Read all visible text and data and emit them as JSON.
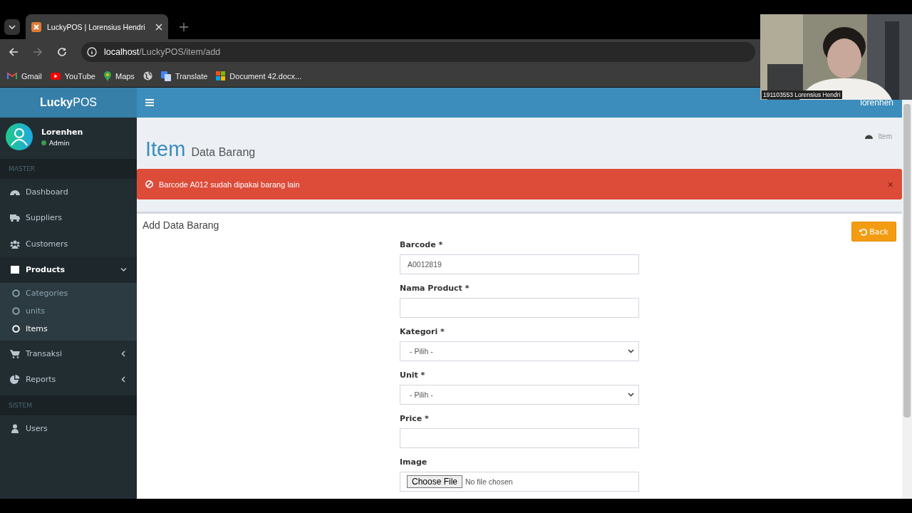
{
  "browser": {
    "tabs": [
      {
        "title": "LuckyPOS | Lorensius Hendri",
        "selected": true
      }
    ],
    "address": {
      "host": "localhost",
      "path": "/LuckyPOS/item/add"
    },
    "bookmarks": [
      "Gmail",
      "YouTube",
      "Maps",
      "Translate",
      "Document 42.docx..."
    ]
  },
  "webcam": {
    "caption": "191103553 Lorensius Hendri"
  },
  "app": {
    "brand": {
      "bold": "Lucky",
      "rest": "POS"
    },
    "header_user": "lorenhen",
    "user": {
      "name": "Lorenhen",
      "status": "Admin"
    },
    "sidebar": [
      {
        "kind": "header",
        "label": "MASTER"
      },
      {
        "kind": "item",
        "label": "Dashboard",
        "selected": false
      },
      {
        "kind": "item",
        "label": "Suppliers",
        "selected": false
      },
      {
        "kind": "item",
        "label": "Customers",
        "selected": false
      },
      {
        "kind": "tree",
        "label": "Products",
        "selected": true,
        "expanded": true,
        "children": [
          {
            "label": "Categories",
            "selected": false
          },
          {
            "label": "units",
            "selected": false
          },
          {
            "label": "Items",
            "selected": true
          }
        ]
      },
      {
        "kind": "tree",
        "label": "Transaksi",
        "selected": false,
        "expanded": false
      },
      {
        "kind": "tree",
        "label": "Reports",
        "selected": false,
        "expanded": false
      },
      {
        "kind": "header",
        "label": "SISTEM"
      },
      {
        "kind": "item",
        "label": "Users",
        "selected": false
      }
    ],
    "title": "Item",
    "subtitle": "Data Barang",
    "breadcrumb": [
      "Item"
    ],
    "alert": {
      "text": "Barcode A012 sudah dipakai barang lain",
      "close": "×"
    },
    "box_title": "Add Data Barang",
    "back_button": "Back",
    "fields": [
      {
        "kind": "text",
        "label": "Barcode *",
        "value": "A0012819"
      },
      {
        "kind": "text",
        "label": "Nama Product *"
      },
      {
        "kind": "select",
        "label": "Kategori *",
        "value": "- Pilih -"
      },
      {
        "kind": "select",
        "label": "Unit *",
        "value": "- Pilih -"
      },
      {
        "kind": "text",
        "label": "Price *"
      },
      {
        "kind": "file",
        "label": "Image",
        "button": "Choose File",
        "value": "No file chosen"
      }
    ]
  }
}
